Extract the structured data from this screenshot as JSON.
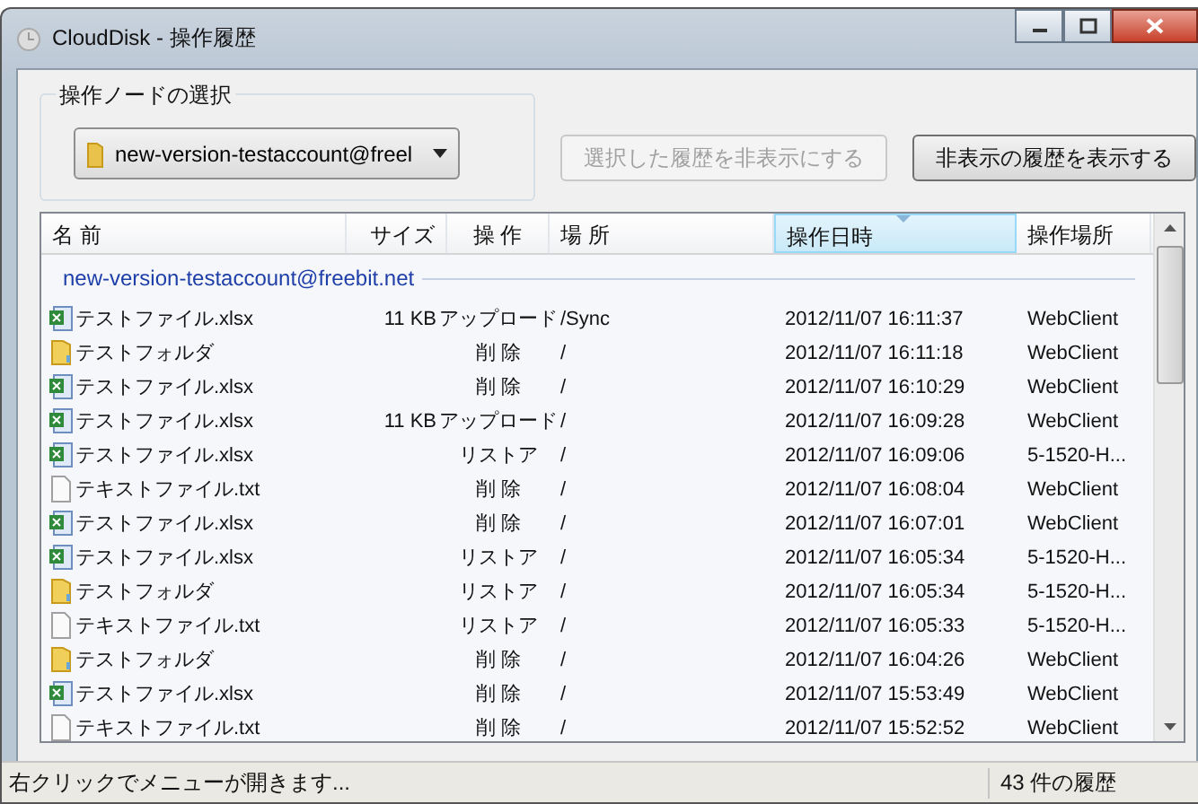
{
  "window": {
    "title": "CloudDisk - 操作履歴"
  },
  "node_group": {
    "label": "操作ノードの選択",
    "dropdown_value": "new-version-testaccount@freel"
  },
  "buttons": [
    {
      "label": "選択した履歴を非表示にする",
      "disabled": true
    },
    {
      "label": "非表示の履歴を表示する",
      "disabled": false
    }
  ],
  "table": {
    "columns": [
      {
        "label": "名 前",
        "selected": false
      },
      {
        "label": "サイズ",
        "selected": false
      },
      {
        "label": "操 作",
        "selected": false
      },
      {
        "label": "場 所",
        "selected": false
      },
      {
        "label": "操作日時",
        "selected": true
      },
      {
        "label": "操作場所",
        "selected": false
      }
    ],
    "group": "new-version-testaccount@freebit.net",
    "rows": [
      {
        "kind": "xlsx",
        "name": "テストファイル.xlsx",
        "size": "11 KB",
        "operation": "アップロード",
        "place": "/Sync",
        "datetime": "2012/11/07 16:11:37",
        "location": "WebClient"
      },
      {
        "kind": "folder",
        "name": "テストフォルダ",
        "size": "",
        "operation": "削 除",
        "place": "/",
        "datetime": "2012/11/07 16:11:18",
        "location": "WebClient"
      },
      {
        "kind": "xlsx",
        "name": "テストファイル.xlsx",
        "size": "",
        "operation": "削 除",
        "place": "/",
        "datetime": "2012/11/07 16:10:29",
        "location": "WebClient"
      },
      {
        "kind": "xlsx",
        "name": "テストファイル.xlsx",
        "size": "11 KB",
        "operation": "アップロード",
        "place": "/",
        "datetime": "2012/11/07 16:09:28",
        "location": "WebClient"
      },
      {
        "kind": "xlsx",
        "name": "テストファイル.xlsx",
        "size": "",
        "operation": "リストア",
        "place": "/",
        "datetime": "2012/11/07 16:09:06",
        "location": "5-1520-H..."
      },
      {
        "kind": "txt",
        "name": "テキストファイル.txt",
        "size": "",
        "operation": "削 除",
        "place": "/",
        "datetime": "2012/11/07 16:08:04",
        "location": "WebClient"
      },
      {
        "kind": "xlsx",
        "name": "テストファイル.xlsx",
        "size": "",
        "operation": "削 除",
        "place": "/",
        "datetime": "2012/11/07 16:07:01",
        "location": "WebClient"
      },
      {
        "kind": "xlsx",
        "name": "テストファイル.xlsx",
        "size": "",
        "operation": "リストア",
        "place": "/",
        "datetime": "2012/11/07 16:05:34",
        "location": "5-1520-H..."
      },
      {
        "kind": "folder",
        "name": "テストフォルダ",
        "size": "",
        "operation": "リストア",
        "place": "/",
        "datetime": "2012/11/07 16:05:34",
        "location": "5-1520-H..."
      },
      {
        "kind": "txt",
        "name": "テキストファイル.txt",
        "size": "",
        "operation": "リストア",
        "place": "/",
        "datetime": "2012/11/07 16:05:33",
        "location": "5-1520-H..."
      },
      {
        "kind": "folder",
        "name": "テストフォルダ",
        "size": "",
        "operation": "削 除",
        "place": "/",
        "datetime": "2012/11/07 16:04:26",
        "location": "WebClient"
      },
      {
        "kind": "xlsx",
        "name": "テストファイル.xlsx",
        "size": "",
        "operation": "削 除",
        "place": "/",
        "datetime": "2012/11/07 15:53:49",
        "location": "WebClient"
      },
      {
        "kind": "txt",
        "name": "テキストファイル.txt",
        "size": "",
        "operation": "削 除",
        "place": "/",
        "datetime": "2012/11/07 15:52:52",
        "location": "WebClient"
      }
    ]
  },
  "status_bar": {
    "hint": "右クリックでメニューが開きます...",
    "count": "43 件の履歴"
  }
}
